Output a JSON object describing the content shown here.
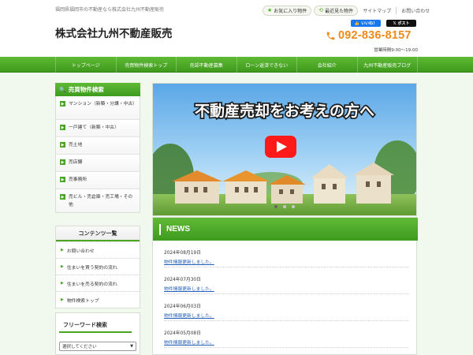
{
  "header": {
    "tagline": "福岡県福岡市の不動産なら株式会社九州不動産販売",
    "company_name": "株式会社九州不動産販売",
    "favorites_label": "お気に入り物件",
    "recent_label": "最近見た物件",
    "sitemap_label": "サイトマップ",
    "contact_label": "お問い合わせ",
    "fb_like_label": "いいね！",
    "tweet_label": "ポスト",
    "phone": "092-836-8157",
    "hours": "営業時間9:00～19:00"
  },
  "nav": {
    "items": [
      {
        "label": "トップページ"
      },
      {
        "label": "売買物件検索トップ"
      },
      {
        "label": "売却不動産募集"
      },
      {
        "label": "ローン返済できない"
      },
      {
        "label": "会社紹介"
      },
      {
        "label": "九州不動産販売ブログ"
      }
    ]
  },
  "sidebar": {
    "search_title": "売買物件検索",
    "search_items": [
      {
        "label": "マンション（新築・分譲・中古）"
      },
      {
        "label": "一戸建て（新築・中古）"
      },
      {
        "label": "売土地"
      },
      {
        "label": "売店舗"
      },
      {
        "label": "売事務所"
      },
      {
        "label": "売ビル・売倉庫・売工場・その他"
      }
    ],
    "contents_title": "コンテンツ一覧",
    "contents_items": [
      {
        "label": "お問い合わせ"
      },
      {
        "label": "住まいを買う契約の流れ"
      },
      {
        "label": "住まいを売る契約の流れ"
      },
      {
        "label": "物件検索トップ"
      }
    ],
    "freeword_title": "フリーワード検索",
    "freeword_select": "選択してください"
  },
  "hero": {
    "banner_text": "不動産売却をお考えの方へ"
  },
  "news": {
    "title": "NEWS",
    "entries": [
      {
        "date": "2024年08月19日",
        "text": "物件情報更新しました。"
      },
      {
        "date": "2024年07月30日",
        "text": "物件情報更新しました。"
      },
      {
        "date": "2024年06月03日",
        "text": "物件情報更新しました。"
      },
      {
        "date": "2024年05月08日",
        "text": "物件情報更新しました。"
      }
    ]
  },
  "colors": {
    "accent_green": "#4aa525",
    "phone_orange": "#ef8a1a",
    "link_blue": "#2560b9"
  }
}
